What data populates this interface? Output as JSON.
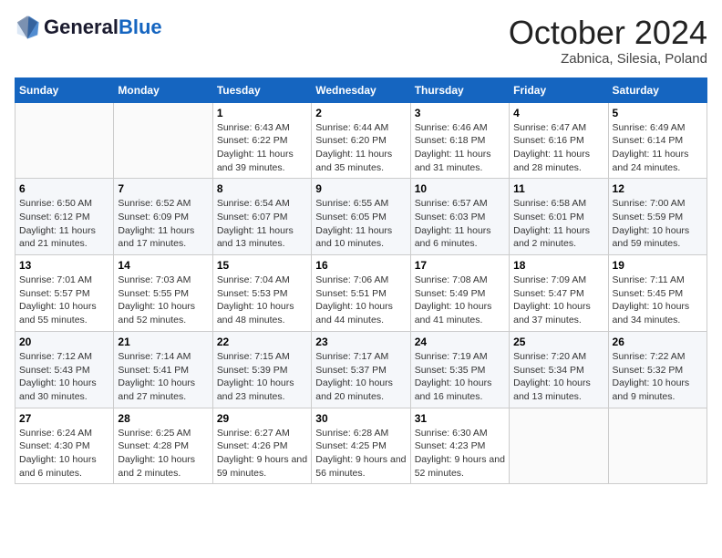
{
  "header": {
    "logo_line1": "General",
    "logo_line2": "Blue",
    "month_title": "October 2024",
    "location": "Zabnica, Silesia, Poland"
  },
  "days_of_week": [
    "Sunday",
    "Monday",
    "Tuesday",
    "Wednesday",
    "Thursday",
    "Friday",
    "Saturday"
  ],
  "weeks": [
    [
      {
        "day": "",
        "info": ""
      },
      {
        "day": "",
        "info": ""
      },
      {
        "day": "1",
        "info": "Sunrise: 6:43 AM\nSunset: 6:22 PM\nDaylight: 11 hours and 39 minutes."
      },
      {
        "day": "2",
        "info": "Sunrise: 6:44 AM\nSunset: 6:20 PM\nDaylight: 11 hours and 35 minutes."
      },
      {
        "day": "3",
        "info": "Sunrise: 6:46 AM\nSunset: 6:18 PM\nDaylight: 11 hours and 31 minutes."
      },
      {
        "day": "4",
        "info": "Sunrise: 6:47 AM\nSunset: 6:16 PM\nDaylight: 11 hours and 28 minutes."
      },
      {
        "day": "5",
        "info": "Sunrise: 6:49 AM\nSunset: 6:14 PM\nDaylight: 11 hours and 24 minutes."
      }
    ],
    [
      {
        "day": "6",
        "info": "Sunrise: 6:50 AM\nSunset: 6:12 PM\nDaylight: 11 hours and 21 minutes."
      },
      {
        "day": "7",
        "info": "Sunrise: 6:52 AM\nSunset: 6:09 PM\nDaylight: 11 hours and 17 minutes."
      },
      {
        "day": "8",
        "info": "Sunrise: 6:54 AM\nSunset: 6:07 PM\nDaylight: 11 hours and 13 minutes."
      },
      {
        "day": "9",
        "info": "Sunrise: 6:55 AM\nSunset: 6:05 PM\nDaylight: 11 hours and 10 minutes."
      },
      {
        "day": "10",
        "info": "Sunrise: 6:57 AM\nSunset: 6:03 PM\nDaylight: 11 hours and 6 minutes."
      },
      {
        "day": "11",
        "info": "Sunrise: 6:58 AM\nSunset: 6:01 PM\nDaylight: 11 hours and 2 minutes."
      },
      {
        "day": "12",
        "info": "Sunrise: 7:00 AM\nSunset: 5:59 PM\nDaylight: 10 hours and 59 minutes."
      }
    ],
    [
      {
        "day": "13",
        "info": "Sunrise: 7:01 AM\nSunset: 5:57 PM\nDaylight: 10 hours and 55 minutes."
      },
      {
        "day": "14",
        "info": "Sunrise: 7:03 AM\nSunset: 5:55 PM\nDaylight: 10 hours and 52 minutes."
      },
      {
        "day": "15",
        "info": "Sunrise: 7:04 AM\nSunset: 5:53 PM\nDaylight: 10 hours and 48 minutes."
      },
      {
        "day": "16",
        "info": "Sunrise: 7:06 AM\nSunset: 5:51 PM\nDaylight: 10 hours and 44 minutes."
      },
      {
        "day": "17",
        "info": "Sunrise: 7:08 AM\nSunset: 5:49 PM\nDaylight: 10 hours and 41 minutes."
      },
      {
        "day": "18",
        "info": "Sunrise: 7:09 AM\nSunset: 5:47 PM\nDaylight: 10 hours and 37 minutes."
      },
      {
        "day": "19",
        "info": "Sunrise: 7:11 AM\nSunset: 5:45 PM\nDaylight: 10 hours and 34 minutes."
      }
    ],
    [
      {
        "day": "20",
        "info": "Sunrise: 7:12 AM\nSunset: 5:43 PM\nDaylight: 10 hours and 30 minutes."
      },
      {
        "day": "21",
        "info": "Sunrise: 7:14 AM\nSunset: 5:41 PM\nDaylight: 10 hours and 27 minutes."
      },
      {
        "day": "22",
        "info": "Sunrise: 7:15 AM\nSunset: 5:39 PM\nDaylight: 10 hours and 23 minutes."
      },
      {
        "day": "23",
        "info": "Sunrise: 7:17 AM\nSunset: 5:37 PM\nDaylight: 10 hours and 20 minutes."
      },
      {
        "day": "24",
        "info": "Sunrise: 7:19 AM\nSunset: 5:35 PM\nDaylight: 10 hours and 16 minutes."
      },
      {
        "day": "25",
        "info": "Sunrise: 7:20 AM\nSunset: 5:34 PM\nDaylight: 10 hours and 13 minutes."
      },
      {
        "day": "26",
        "info": "Sunrise: 7:22 AM\nSunset: 5:32 PM\nDaylight: 10 hours and 9 minutes."
      }
    ],
    [
      {
        "day": "27",
        "info": "Sunrise: 6:24 AM\nSunset: 4:30 PM\nDaylight: 10 hours and 6 minutes."
      },
      {
        "day": "28",
        "info": "Sunrise: 6:25 AM\nSunset: 4:28 PM\nDaylight: 10 hours and 2 minutes."
      },
      {
        "day": "29",
        "info": "Sunrise: 6:27 AM\nSunset: 4:26 PM\nDaylight: 9 hours and 59 minutes."
      },
      {
        "day": "30",
        "info": "Sunrise: 6:28 AM\nSunset: 4:25 PM\nDaylight: 9 hours and 56 minutes."
      },
      {
        "day": "31",
        "info": "Sunrise: 6:30 AM\nSunset: 4:23 PM\nDaylight: 9 hours and 52 minutes."
      },
      {
        "day": "",
        "info": ""
      },
      {
        "day": "",
        "info": ""
      }
    ]
  ]
}
